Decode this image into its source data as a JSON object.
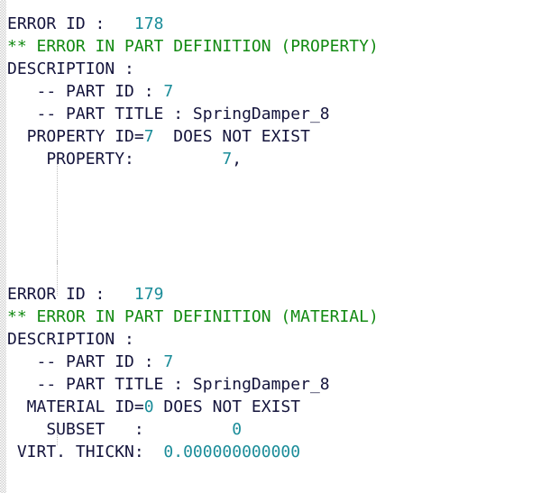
{
  "document": {
    "type": "solver-error-log",
    "title": "Error listing output",
    "font_colors": {
      "text": "#14143c",
      "error_header": "#128a12",
      "number": "#1a8c99",
      "background": "#ffffff",
      "gutter": "#c9c9c9"
    }
  },
  "lines": [
    {
      "id": "l1",
      "segments": [
        {
          "text": "ERROR ID :   ",
          "style": "plain"
        },
        {
          "text": "178",
          "style": "teal"
        }
      ]
    },
    {
      "id": "l2",
      "segments": [
        {
          "text": "** ERROR IN PART DEFINITION (PROPERTY)",
          "style": "green"
        }
      ]
    },
    {
      "id": "l3",
      "segments": [
        {
          "text": "DESCRIPTION :",
          "style": "plain"
        }
      ]
    },
    {
      "id": "l4",
      "segments": [
        {
          "text": "   -- PART ID : ",
          "style": "plain"
        },
        {
          "text": "7",
          "style": "teal"
        }
      ]
    },
    {
      "id": "l5",
      "segments": [
        {
          "text": "   -- PART TITLE : SpringDamper_8",
          "style": "plain"
        }
      ]
    },
    {
      "id": "l6",
      "segments": [
        {
          "text": "  PROPERTY ID=",
          "style": "plain"
        },
        {
          "text": "7",
          "style": "teal"
        },
        {
          "text": "  DOES NOT EXIST",
          "style": "plain"
        }
      ]
    },
    {
      "id": "l7",
      "segments": [
        {
          "text": "    PROPERTY:         ",
          "style": "plain"
        },
        {
          "text": "7",
          "style": "teal"
        },
        {
          "text": ",",
          "style": "plain"
        }
      ]
    },
    {
      "id": "l8",
      "segments": [
        {
          "text": " ",
          "style": "plain"
        }
      ]
    },
    {
      "id": "l9",
      "segments": [
        {
          "text": " ",
          "style": "plain"
        }
      ]
    },
    {
      "id": "l10",
      "segments": [
        {
          "text": " ",
          "style": "plain"
        }
      ]
    },
    {
      "id": "l11",
      "segments": [
        {
          "text": " ",
          "style": "plain"
        }
      ]
    },
    {
      "id": "l12",
      "segments": [
        {
          "text": " ",
          "style": "plain"
        }
      ]
    },
    {
      "id": "l13",
      "segments": [
        {
          "text": "ERROR ID :   ",
          "style": "plain"
        },
        {
          "text": "179",
          "style": "teal"
        }
      ]
    },
    {
      "id": "l14",
      "segments": [
        {
          "text": "** ERROR IN PART DEFINITION (MATERIAL)",
          "style": "green"
        }
      ]
    },
    {
      "id": "l15",
      "segments": [
        {
          "text": "DESCRIPTION :",
          "style": "plain"
        }
      ]
    },
    {
      "id": "l16",
      "segments": [
        {
          "text": "   -- PART ID : ",
          "style": "plain"
        },
        {
          "text": "7",
          "style": "teal"
        }
      ]
    },
    {
      "id": "l17",
      "segments": [
        {
          "text": "   -- PART TITLE : SpringDamper_8",
          "style": "plain"
        }
      ]
    },
    {
      "id": "l18",
      "segments": [
        {
          "text": "  MATERIAL ID=",
          "style": "plain"
        },
        {
          "text": "0",
          "style": "teal"
        },
        {
          "text": " DOES NOT EXIST",
          "style": "plain"
        }
      ]
    },
    {
      "id": "l19",
      "segments": [
        {
          "text": "    SUBSET   :         ",
          "style": "plain"
        },
        {
          "text": "0",
          "style": "teal"
        }
      ]
    },
    {
      "id": "l20",
      "segments": [
        {
          "text": " VIRT. THICKN:  ",
          "style": "plain"
        },
        {
          "text": "0.000000000000",
          "style": "teal"
        }
      ]
    }
  ]
}
